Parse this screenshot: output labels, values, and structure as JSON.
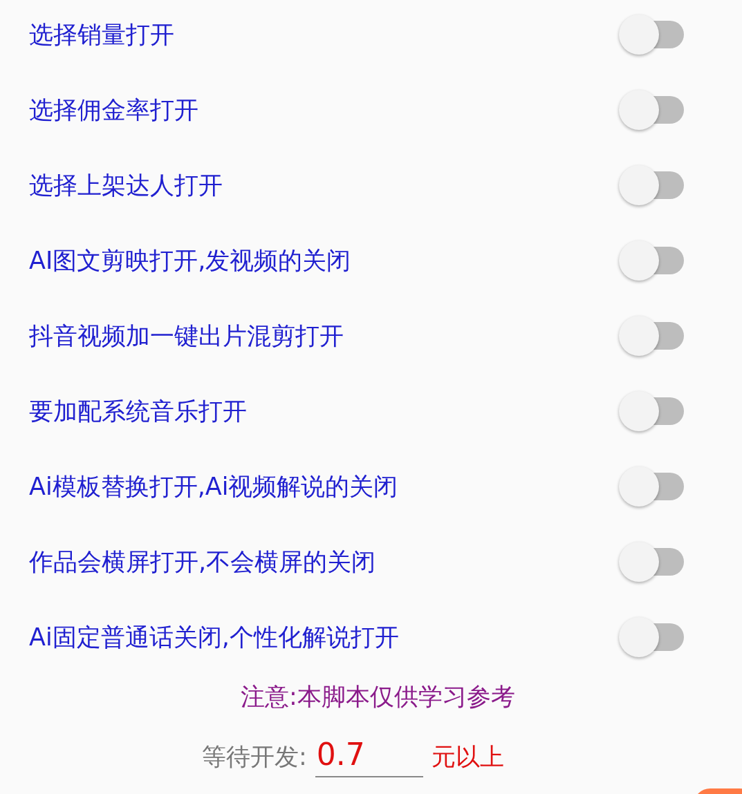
{
  "settings": [
    {
      "label": "选择销量打开",
      "on": false
    },
    {
      "label": "选择佣金率打开",
      "on": false
    },
    {
      "label": "选择上架达人打开",
      "on": false
    },
    {
      "label": "AI图文剪映打开,发视频的关闭",
      "on": false
    },
    {
      "label": "抖音视频加一键出片混剪打开",
      "on": false
    },
    {
      "label": "要加配系统音乐打开",
      "on": false
    },
    {
      "label": "Ai模板替换打开,Ai视频解说的关闭",
      "on": false
    },
    {
      "label": "作品会横屏打开,不会横屏的关闭",
      "on": false
    },
    {
      "label": "Ai固定普通话关闭,个性化解说打开",
      "on": false
    }
  ],
  "notice": "注意:本脚本仅供学习参考",
  "price": {
    "label": "等待开发:",
    "value": "0.7",
    "unit": "元以上"
  }
}
